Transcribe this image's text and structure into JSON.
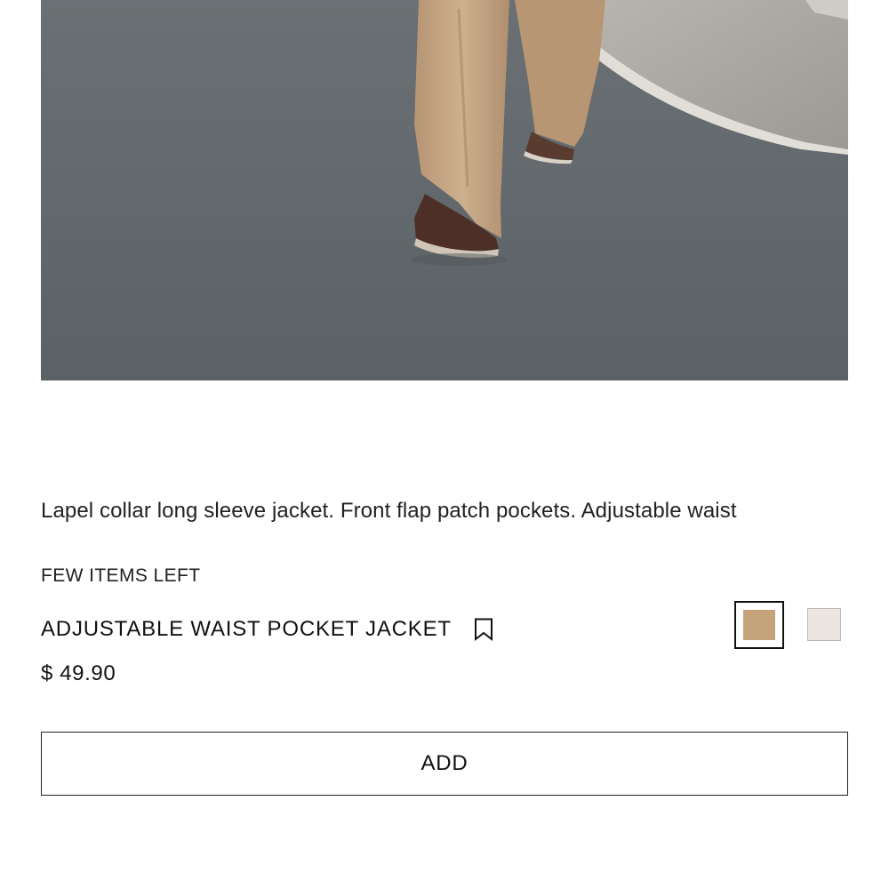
{
  "product": {
    "image_alt": "Model wearing beige wide-leg trousers and brown shoes walking on grey pavement",
    "description": "Lapel collar long sleeve jacket. Front flap patch pockets. Adjustable waist",
    "stock_status": "FEW ITEMS LEFT",
    "name": "ADJUSTABLE WAIST POCKET JACKET",
    "price": "$ 49.90",
    "colors": [
      {
        "name": "camel",
        "hex": "#c4a37b",
        "selected": true
      },
      {
        "name": "ecru",
        "hex": "#ebe6e2",
        "selected": false
      }
    ],
    "add_label": "ADD"
  },
  "icons": {
    "bookmark": "bookmark-icon"
  }
}
